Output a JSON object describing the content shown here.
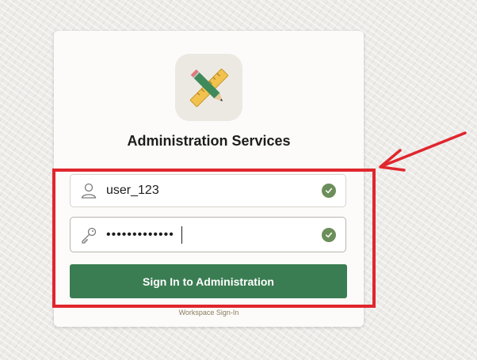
{
  "login": {
    "title": "Administration Services",
    "username": {
      "value": "user_123",
      "icon": "user-icon",
      "status_icon": "check-icon"
    },
    "password": {
      "value": "•••••••••••••",
      "icon": "key-icon",
      "status_icon": "check-icon"
    },
    "signin_label": "Sign In to Administration",
    "workspace_link": "Workspace Sign-In"
  },
  "colors": {
    "button": "#3a7d52",
    "check": "#6b8e5a",
    "annotation": "#e0262d",
    "background": "#ecebe8"
  }
}
